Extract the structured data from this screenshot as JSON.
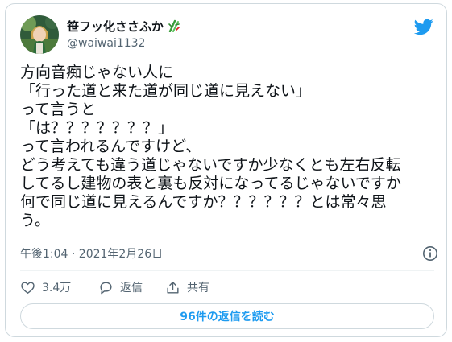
{
  "tweet": {
    "author": {
      "display_name": "笹フッ化ささふか",
      "handle": "@waiwai1132",
      "display_name_emoji": "bamboo-icon"
    },
    "body": "方向音痴じゃない人に\n「行った道と来た道が同じ道に見えない」\nって言うと\n「は？？？？？？？」\nって言われるんですけど、\nどう考えても違う道じゃないですか少なくとも左右反転\nしてるし建物の表と裏も反対になってるじゃないですか\n何で同じ道に見えるんですか？？？？？？とは常々思\nう。",
    "timestamp": "午後1:04 · 2021年2月26日",
    "actions": {
      "likes": "3.4万",
      "reply_label": "返信",
      "share_label": "共有"
    },
    "read_replies_label": "96件の返信を読む"
  },
  "colors": {
    "accent": "#1d9bf0",
    "text": "#0f1419",
    "muted": "#536471",
    "border": "#cfd9de"
  }
}
